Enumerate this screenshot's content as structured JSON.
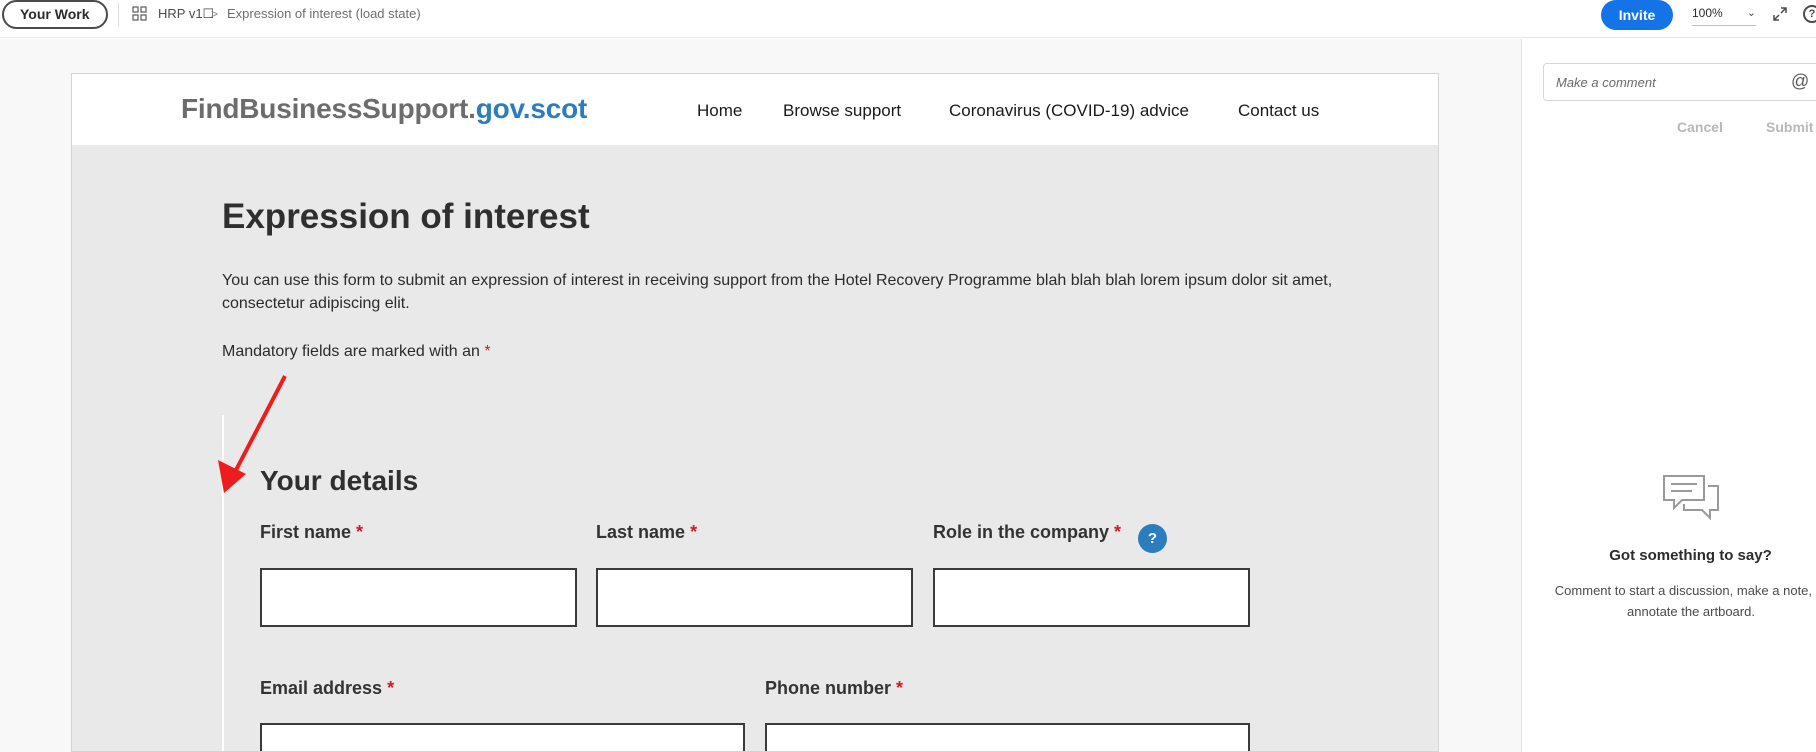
{
  "topbar": {
    "your_work": "Your Work",
    "project": "HRP v1☐",
    "chevron": ">",
    "current_screen": "Expression of interest (load state)",
    "invite": "Invite",
    "zoom": "100%",
    "help": "?"
  },
  "site": {
    "logo_part1": "FindBusinessSupport.",
    "logo_part2": "gov.scot",
    "nav": [
      "Home",
      "Browse support",
      "Coronavirus (COVID-19) advice",
      "Contact us"
    ]
  },
  "page": {
    "title": "Expression of interest",
    "intro": "You can use this form to submit an expression of interest in receiving support from the Hotel Recovery Programme blah blah blah lorem ipsum dolor sit amet, consectetur adipiscing elit.",
    "mandatory_text": "Mandatory fields are marked with an",
    "required_mark": "*",
    "section_title": "Your details",
    "help_symbol": "?",
    "fields": {
      "first_name": "First name",
      "last_name": "Last name",
      "role": "Role in the company",
      "email": "Email address",
      "phone": "Phone number"
    }
  },
  "comments": {
    "placeholder": "Make a comment",
    "at": "@",
    "cancel": "Cancel",
    "submit": "Submit",
    "empty_title": "Got something to say?",
    "empty_line1": "Comment to start a discussion, make a note, or",
    "empty_line2": "annotate the artboard."
  },
  "colors": {
    "accent_blue": "#1473e6",
    "logo_blue": "#2c7dbd",
    "required_red": "#d0192c",
    "annotation_red": "#ee1c1c"
  }
}
